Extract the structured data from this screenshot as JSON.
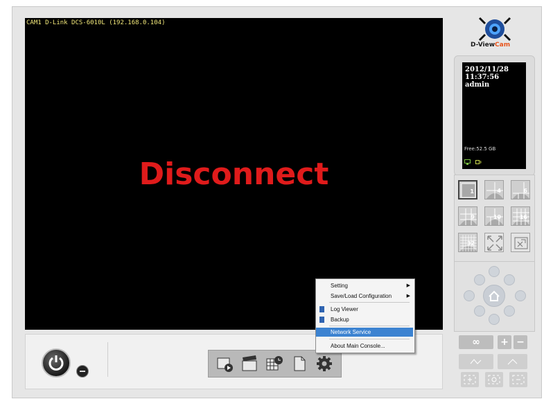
{
  "camera": {
    "title": "CAM1 D-Link DCS-6010L (192.168.0.104)",
    "status_text": "Disconnect"
  },
  "brand": {
    "name_part1": "D-View",
    "name_part2": "Cam",
    "accent": "#e8541b"
  },
  "status": {
    "date": "2012/11/28",
    "time": "11:37:56",
    "user": "admin",
    "free": "Free:52.5 GB"
  },
  "layouts": [
    {
      "label": "1"
    },
    {
      "label": "4"
    },
    {
      "label": "6"
    },
    {
      "label": "9"
    },
    {
      "label": "10"
    },
    {
      "label": "16"
    },
    {
      "label": "32"
    },
    {
      "label": ""
    },
    {
      "label": ""
    }
  ],
  "context_menu": {
    "items": [
      {
        "label": "Setting",
        "has_submenu": true
      },
      {
        "label": "Save/Load Configuration",
        "has_submenu": true
      },
      {
        "label": "Log Viewer",
        "icon": "log-icon"
      },
      {
        "label": "Backup",
        "icon": "backup-icon"
      },
      {
        "label": "Network Service",
        "active": true
      },
      {
        "label": "About Main Console..."
      }
    ]
  },
  "colors": {
    "disconnect": "#e01b1b",
    "menu_highlight": "#3c83d1",
    "timestamp": "#f2e87a"
  }
}
